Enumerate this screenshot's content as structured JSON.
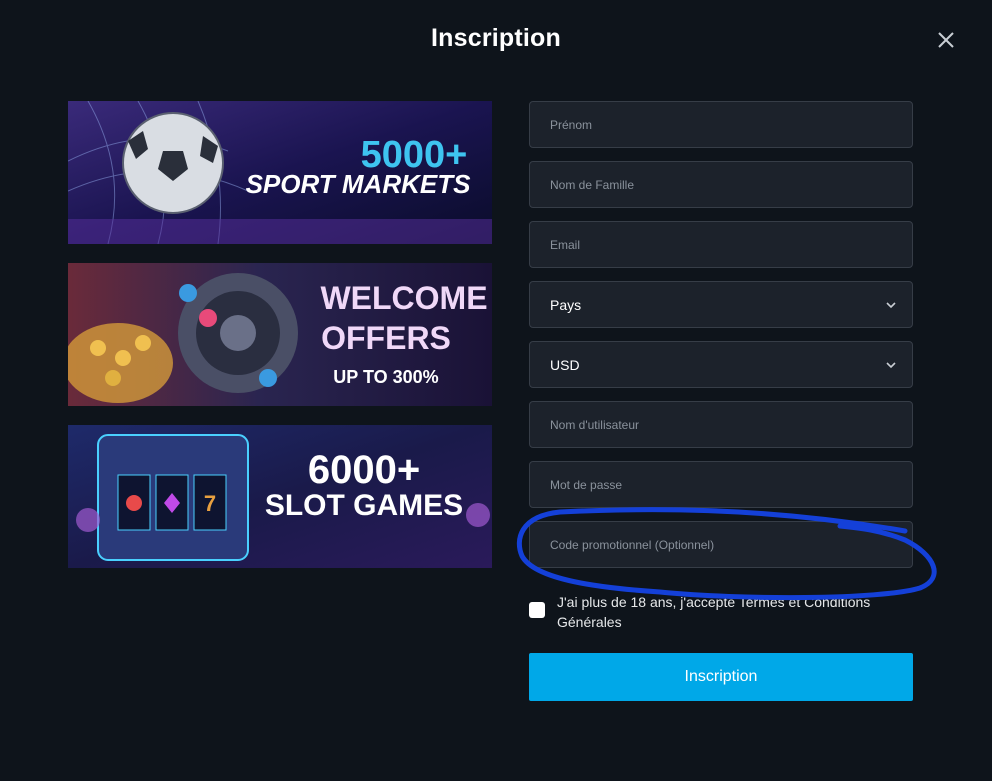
{
  "modal": {
    "title": "Inscription",
    "close_icon": "close-icon"
  },
  "banners": [
    {
      "line1": "5000+",
      "line2": "SPORT MARKETS",
      "line3": ""
    },
    {
      "line1": "WELCOME",
      "line2": "OFFERS",
      "line3": "UP TO 300%"
    },
    {
      "line1": "6000+",
      "line2": "SLOT GAMES",
      "line3": ""
    }
  ],
  "form": {
    "first_name": {
      "placeholder": "Prénom",
      "value": ""
    },
    "last_name": {
      "placeholder": "Nom de Famille",
      "value": ""
    },
    "email": {
      "placeholder": "Email",
      "value": ""
    },
    "country": {
      "value": "Pays"
    },
    "currency": {
      "value": "USD"
    },
    "username": {
      "placeholder": "Nom d'utilisateur",
      "value": ""
    },
    "password": {
      "placeholder": "Mot de passe",
      "value": ""
    },
    "promo_code": {
      "placeholder": "Code promotionnel (Optionnel)",
      "value": ""
    },
    "terms_label": "J'ai plus de 18 ans, j'accepte Termes et Conditions Générales",
    "submit_label": "Inscription"
  },
  "colors": {
    "background": "#0e141b",
    "field_bg": "#1c222b",
    "accent": "#00a8e8",
    "annotation": "#1440d8"
  }
}
